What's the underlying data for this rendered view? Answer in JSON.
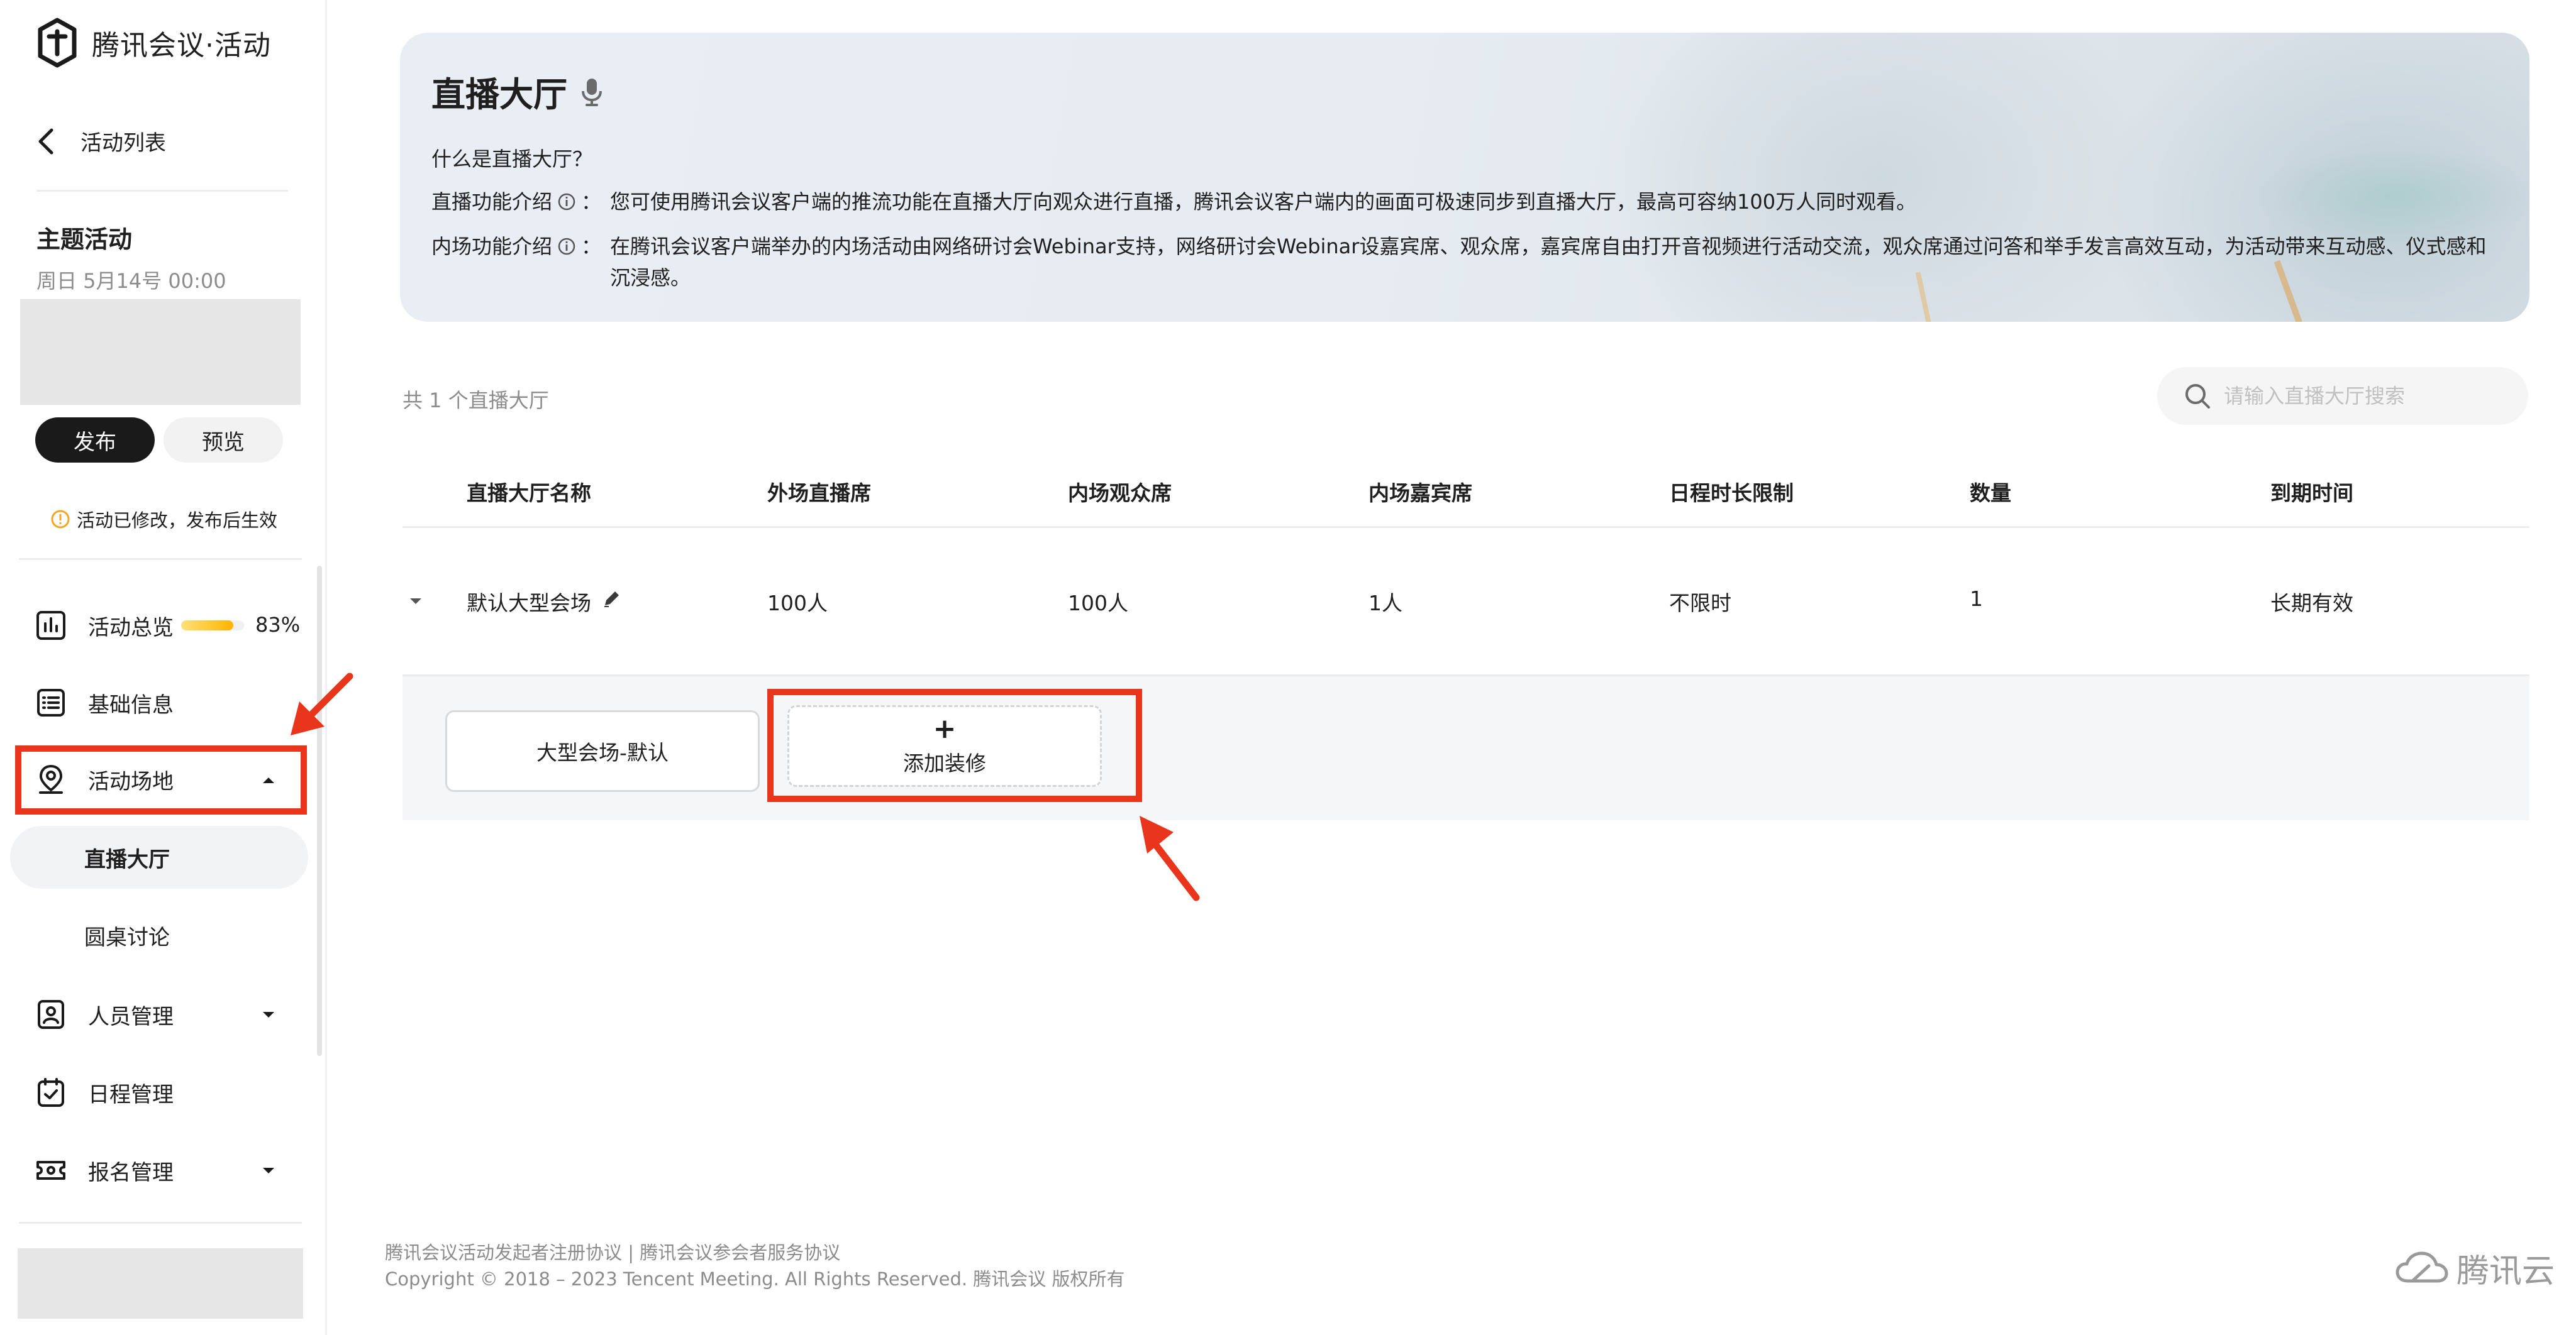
{
  "app": {
    "logo_text": "腾讯会议·活动"
  },
  "sidebar": {
    "back_label": "活动列表",
    "event_title": "主题活动",
    "event_date": "周日  5月14号  00:00",
    "publish_label": "发布",
    "preview_label": "预览",
    "notice": "活动已修改，发布后生效",
    "overview": {
      "label": "活动总览",
      "progress_text": "83%",
      "progress_fraction": 0.83
    },
    "nav": {
      "basic": "基础信息",
      "venue": "活动场地",
      "venue_sub": [
        "直播大厅",
        "圆桌讨论"
      ],
      "people": "人员管理",
      "schedule": "日程管理",
      "signup": "报名管理"
    }
  },
  "banner": {
    "title": "直播大厅",
    "question": "什么是直播大厅？",
    "live_label": "直播功能介绍",
    "live_text": "您可使用腾讯会议客户端的推流功能在直播大厅向观众进行直播，腾讯会议客户端内的画面可极速同步到直播大厅，最高可容纳100万人同时观看。",
    "inner_label": "内场功能介绍",
    "inner_text": "在腾讯会议客户端举办的内场活动由网络研讨会Webinar支持，网络研讨会Webinar设嘉宾席、观众席，嘉宾席自由打开音视频进行活动交流，观众席通过问答和举手发言高效互动，为活动带来互动感、仪式感和沉浸感。",
    "colon": "："
  },
  "list": {
    "count_text": "共 1 个直播大厅",
    "search_placeholder": "请输入直播大厅搜索",
    "columns": [
      "直播大厅名称",
      "外场直播席",
      "内场观众席",
      "内场嘉宾席",
      "日程时长限制",
      "数量",
      "到期时间"
    ],
    "rows": [
      [
        "默认大型会场",
        "100人",
        "100人",
        "1人",
        "不限时",
        "1",
        "长期有效"
      ]
    ],
    "decorations": {
      "default_label": "大型会场-默认",
      "add_plus": "+",
      "add_label": "添加装修"
    }
  },
  "footer": {
    "links": "腾讯会议活动发起者注册协议 | 腾讯会议参会者服务协议",
    "copyright": "Copyright © 2018 – 2023 Tencent Meeting. All Rights Reserved. 腾讯会议 版权所有",
    "brand": "腾讯云"
  },
  "colors": {
    "annotation_red": "#e8351c",
    "dark_button": "#1a1a1a",
    "progress": "#ffb400"
  },
  "icons": [
    "logo-icon",
    "back-chevron-icon",
    "warning-icon",
    "chart-icon",
    "list-icon",
    "location-pin-icon",
    "person-card-icon",
    "calendar-check-icon",
    "ticket-icon",
    "chevron-down-icon",
    "chevron-up-icon",
    "edit-pencil-icon",
    "info-icon",
    "search-icon",
    "cloud-logo-icon"
  ]
}
